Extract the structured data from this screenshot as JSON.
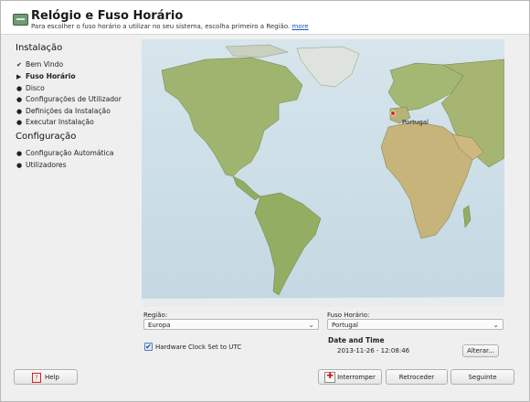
{
  "header": {
    "title": "Relógio e Fuso Horário",
    "subtitle": "Para escolher o fuso horário a utilizar no seu sistema, escolha primeiro a Região.",
    "more_link": "more",
    "icon": "clock-icon"
  },
  "sidebar": {
    "sections": [
      {
        "title": "Instalação",
        "items": [
          {
            "label": "Bem Vindo",
            "state": "done",
            "marker": "✔"
          },
          {
            "label": "Fuso Horário",
            "state": "current",
            "marker": "▶"
          },
          {
            "label": "Disco",
            "state": "pending",
            "marker": "●"
          },
          {
            "label": "Configurações de Utilizador",
            "state": "pending",
            "marker": "●"
          },
          {
            "label": "Definições da Instalação",
            "state": "pending",
            "marker": "●"
          },
          {
            "label": "Executar Instalação",
            "state": "pending",
            "marker": "●"
          }
        ]
      },
      {
        "title": "Configuração",
        "items": [
          {
            "label": "Configuração Automática",
            "state": "pending",
            "marker": "●"
          },
          {
            "label": "Utilizadores",
            "state": "pending",
            "marker": "●"
          }
        ]
      }
    ]
  },
  "map": {
    "marker_label": "Portugal",
    "ocean_color": "#c9dde6",
    "land_color": "#9fb56f",
    "marker_color": "#e02020"
  },
  "region": {
    "label": "Região:",
    "value": "Europa"
  },
  "timezone": {
    "label": "Fuso Horário:",
    "value": "Portugal"
  },
  "hardware_clock": {
    "label": "Hardware Clock Set to UTC",
    "checked": true
  },
  "datetime": {
    "title": "Date and Time",
    "value": "2013-11-26 - 12:08:46",
    "change_button": "Alterar..."
  },
  "buttons": {
    "help": "Help",
    "abort": "Interromper",
    "back": "Retroceder",
    "next": "Seguinte"
  }
}
